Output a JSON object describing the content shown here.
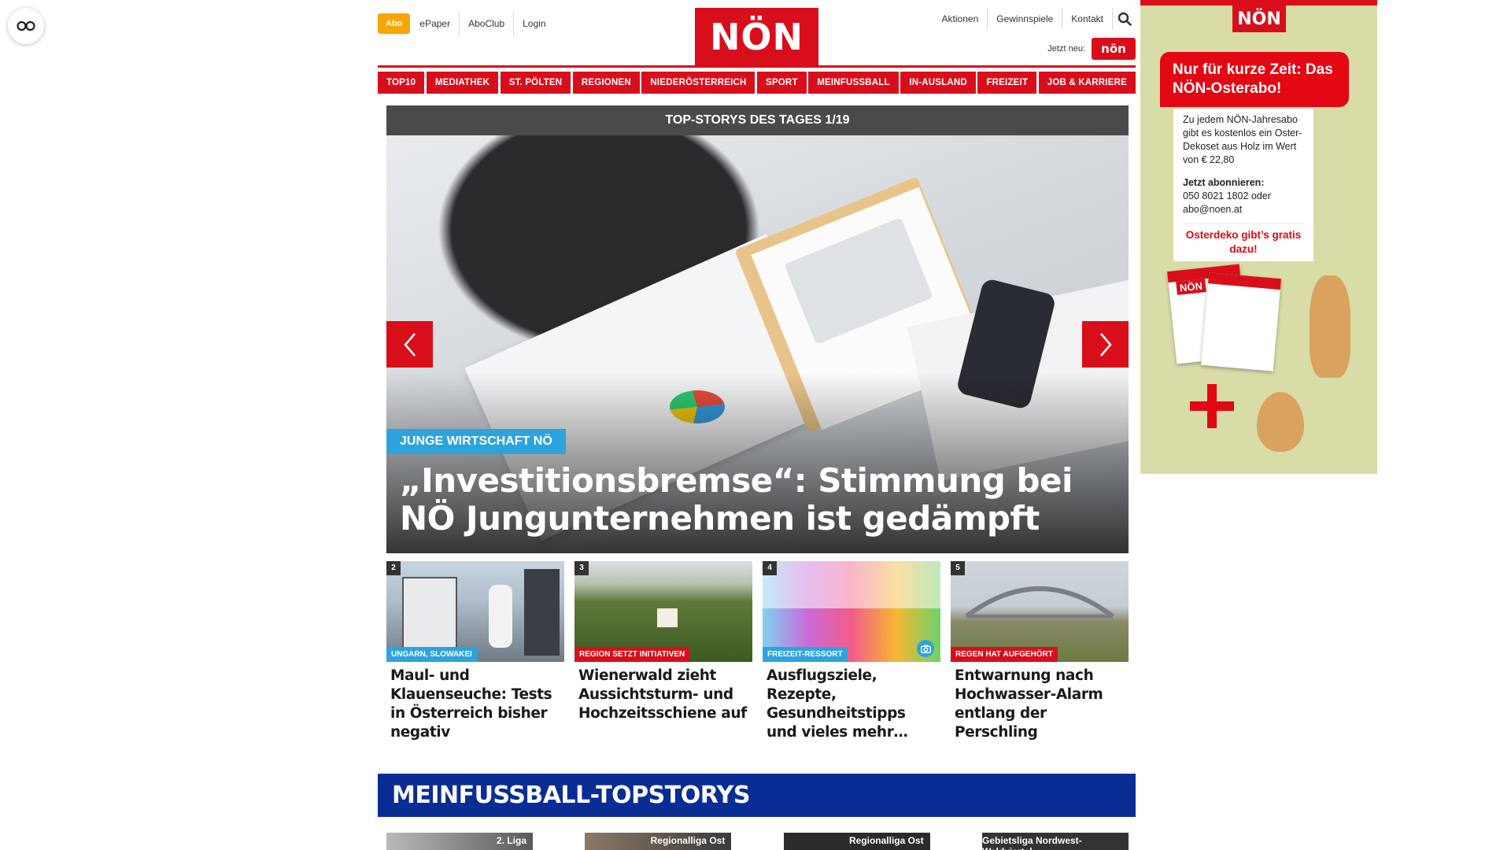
{
  "reader": {
    "icon": "glasses-icon"
  },
  "header": {
    "abo_label": "Abo",
    "left_links": [
      "ePaper",
      "AboClub",
      "Login"
    ],
    "logo_text": "NÖN",
    "right_links": [
      "Aktionen",
      "Gewinnspiele",
      "Kontakt"
    ],
    "search_icon": "search-icon",
    "jetzt_neu_label": "Jetzt neu:",
    "jetzt_neu_logo": "nön"
  },
  "nav": {
    "items": [
      "TOP10",
      "MEDIATHEK",
      "ST. PÖLTEN",
      "REGIONEN",
      "NIEDERÖSTERREICH",
      "SPORT",
      "MEINFUSSBALL",
      "IN-AUSLAND",
      "FREIZEIT",
      "JOB & KARRIERE"
    ],
    "color": "#d80f1b"
  },
  "top_stories": {
    "bar_label": "TOP-STORYS DES TAGES 1/19",
    "hero": {
      "tag": "JUNGE WIRTSCHAFT NÖ",
      "title": "„Investitionsbremse“: Stimmung bei NÖ Jungunternehmen ist gedämpft",
      "tag_color": "#2da3dd"
    },
    "prev_icon": "chevron-left-icon",
    "next_icon": "chevron-right-icon",
    "cards": [
      {
        "num": "2",
        "tag": "UNGARN, SLOWAKEI",
        "tag_color": "#2da3dd",
        "title": "Maul- und Klauenseuche: Tests in Österreich bisher negativ"
      },
      {
        "num": "3",
        "tag": "REGION SETZT INITIATIVEN",
        "tag_color": "#d80f1b",
        "title": "Wienerwald zieht Aussichtsturm- und Hochzeitsschiene auf"
      },
      {
        "num": "4",
        "tag": "FREIZEIT-RESSORT",
        "tag_color": "#2da3dd",
        "title": "Ausflugsziele, Rezepte, Gesundheitstipps und vieles mehr…",
        "icon": "camera-icon"
      },
      {
        "num": "5",
        "tag": "REGEN HAT AUFGEHÖRT",
        "tag_color": "#d80f1b",
        "title": "Entwarnung nach Hochwasser-Alarm entlang der Perschling"
      }
    ]
  },
  "meinfussball": {
    "title": "MEINFUSSBALL-TOPSTORYS",
    "labels": [
      "2. Liga",
      "Regionalliga Ost",
      "Regionalliga Ost",
      "Gebietsliga Nordwest-Waldviertel"
    ]
  },
  "ad": {
    "logo": "NÖN",
    "headline": "Nur für kurze Zeit: Das NÖN-Osterabo!",
    "body": "Zu jedem NÖN-Jahresabo gibt es kostenlos ein Oster-Dekoset aus Holz im Wert von € 22,80",
    "cta_label": "Jetzt abonnieren:",
    "cta_contact": "050 8021 1802 oder abo@noen.at",
    "promo": "Osterdeko gibt’s gratis dazu!",
    "paper_logo": "NÖN"
  }
}
